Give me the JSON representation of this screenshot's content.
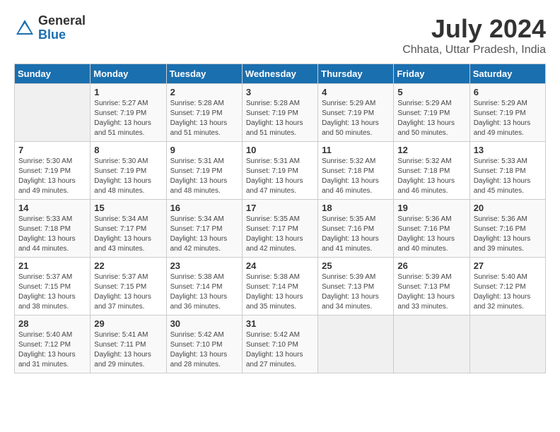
{
  "header": {
    "logo_general": "General",
    "logo_blue": "Blue",
    "month_year": "July 2024",
    "location": "Chhata, Uttar Pradesh, India"
  },
  "days_of_week": [
    "Sunday",
    "Monday",
    "Tuesday",
    "Wednesday",
    "Thursday",
    "Friday",
    "Saturday"
  ],
  "weeks": [
    [
      {
        "day": "",
        "sunrise": "",
        "sunset": "",
        "daylight": ""
      },
      {
        "day": "1",
        "sunrise": "Sunrise: 5:27 AM",
        "sunset": "Sunset: 7:19 PM",
        "daylight": "Daylight: 13 hours and 51 minutes."
      },
      {
        "day": "2",
        "sunrise": "Sunrise: 5:28 AM",
        "sunset": "Sunset: 7:19 PM",
        "daylight": "Daylight: 13 hours and 51 minutes."
      },
      {
        "day": "3",
        "sunrise": "Sunrise: 5:28 AM",
        "sunset": "Sunset: 7:19 PM",
        "daylight": "Daylight: 13 hours and 51 minutes."
      },
      {
        "day": "4",
        "sunrise": "Sunrise: 5:29 AM",
        "sunset": "Sunset: 7:19 PM",
        "daylight": "Daylight: 13 hours and 50 minutes."
      },
      {
        "day": "5",
        "sunrise": "Sunrise: 5:29 AM",
        "sunset": "Sunset: 7:19 PM",
        "daylight": "Daylight: 13 hours and 50 minutes."
      },
      {
        "day": "6",
        "sunrise": "Sunrise: 5:29 AM",
        "sunset": "Sunset: 7:19 PM",
        "daylight": "Daylight: 13 hours and 49 minutes."
      }
    ],
    [
      {
        "day": "7",
        "sunrise": "Sunrise: 5:30 AM",
        "sunset": "Sunset: 7:19 PM",
        "daylight": "Daylight: 13 hours and 49 minutes."
      },
      {
        "day": "8",
        "sunrise": "Sunrise: 5:30 AM",
        "sunset": "Sunset: 7:19 PM",
        "daylight": "Daylight: 13 hours and 48 minutes."
      },
      {
        "day": "9",
        "sunrise": "Sunrise: 5:31 AM",
        "sunset": "Sunset: 7:19 PM",
        "daylight": "Daylight: 13 hours and 48 minutes."
      },
      {
        "day": "10",
        "sunrise": "Sunrise: 5:31 AM",
        "sunset": "Sunset: 7:19 PM",
        "daylight": "Daylight: 13 hours and 47 minutes."
      },
      {
        "day": "11",
        "sunrise": "Sunrise: 5:32 AM",
        "sunset": "Sunset: 7:18 PM",
        "daylight": "Daylight: 13 hours and 46 minutes."
      },
      {
        "day": "12",
        "sunrise": "Sunrise: 5:32 AM",
        "sunset": "Sunset: 7:18 PM",
        "daylight": "Daylight: 13 hours and 46 minutes."
      },
      {
        "day": "13",
        "sunrise": "Sunrise: 5:33 AM",
        "sunset": "Sunset: 7:18 PM",
        "daylight": "Daylight: 13 hours and 45 minutes."
      }
    ],
    [
      {
        "day": "14",
        "sunrise": "Sunrise: 5:33 AM",
        "sunset": "Sunset: 7:18 PM",
        "daylight": "Daylight: 13 hours and 44 minutes."
      },
      {
        "day": "15",
        "sunrise": "Sunrise: 5:34 AM",
        "sunset": "Sunset: 7:17 PM",
        "daylight": "Daylight: 13 hours and 43 minutes."
      },
      {
        "day": "16",
        "sunrise": "Sunrise: 5:34 AM",
        "sunset": "Sunset: 7:17 PM",
        "daylight": "Daylight: 13 hours and 42 minutes."
      },
      {
        "day": "17",
        "sunrise": "Sunrise: 5:35 AM",
        "sunset": "Sunset: 7:17 PM",
        "daylight": "Daylight: 13 hours and 42 minutes."
      },
      {
        "day": "18",
        "sunrise": "Sunrise: 5:35 AM",
        "sunset": "Sunset: 7:16 PM",
        "daylight": "Daylight: 13 hours and 41 minutes."
      },
      {
        "day": "19",
        "sunrise": "Sunrise: 5:36 AM",
        "sunset": "Sunset: 7:16 PM",
        "daylight": "Daylight: 13 hours and 40 minutes."
      },
      {
        "day": "20",
        "sunrise": "Sunrise: 5:36 AM",
        "sunset": "Sunset: 7:16 PM",
        "daylight": "Daylight: 13 hours and 39 minutes."
      }
    ],
    [
      {
        "day": "21",
        "sunrise": "Sunrise: 5:37 AM",
        "sunset": "Sunset: 7:15 PM",
        "daylight": "Daylight: 13 hours and 38 minutes."
      },
      {
        "day": "22",
        "sunrise": "Sunrise: 5:37 AM",
        "sunset": "Sunset: 7:15 PM",
        "daylight": "Daylight: 13 hours and 37 minutes."
      },
      {
        "day": "23",
        "sunrise": "Sunrise: 5:38 AM",
        "sunset": "Sunset: 7:14 PM",
        "daylight": "Daylight: 13 hours and 36 minutes."
      },
      {
        "day": "24",
        "sunrise": "Sunrise: 5:38 AM",
        "sunset": "Sunset: 7:14 PM",
        "daylight": "Daylight: 13 hours and 35 minutes."
      },
      {
        "day": "25",
        "sunrise": "Sunrise: 5:39 AM",
        "sunset": "Sunset: 7:13 PM",
        "daylight": "Daylight: 13 hours and 34 minutes."
      },
      {
        "day": "26",
        "sunrise": "Sunrise: 5:39 AM",
        "sunset": "Sunset: 7:13 PM",
        "daylight": "Daylight: 13 hours and 33 minutes."
      },
      {
        "day": "27",
        "sunrise": "Sunrise: 5:40 AM",
        "sunset": "Sunset: 7:12 PM",
        "daylight": "Daylight: 13 hours and 32 minutes."
      }
    ],
    [
      {
        "day": "28",
        "sunrise": "Sunrise: 5:40 AM",
        "sunset": "Sunset: 7:12 PM",
        "daylight": "Daylight: 13 hours and 31 minutes."
      },
      {
        "day": "29",
        "sunrise": "Sunrise: 5:41 AM",
        "sunset": "Sunset: 7:11 PM",
        "daylight": "Daylight: 13 hours and 29 minutes."
      },
      {
        "day": "30",
        "sunrise": "Sunrise: 5:42 AM",
        "sunset": "Sunset: 7:10 PM",
        "daylight": "Daylight: 13 hours and 28 minutes."
      },
      {
        "day": "31",
        "sunrise": "Sunrise: 5:42 AM",
        "sunset": "Sunset: 7:10 PM",
        "daylight": "Daylight: 13 hours and 27 minutes."
      },
      {
        "day": "",
        "sunrise": "",
        "sunset": "",
        "daylight": ""
      },
      {
        "day": "",
        "sunrise": "",
        "sunset": "",
        "daylight": ""
      },
      {
        "day": "",
        "sunrise": "",
        "sunset": "",
        "daylight": ""
      }
    ]
  ]
}
